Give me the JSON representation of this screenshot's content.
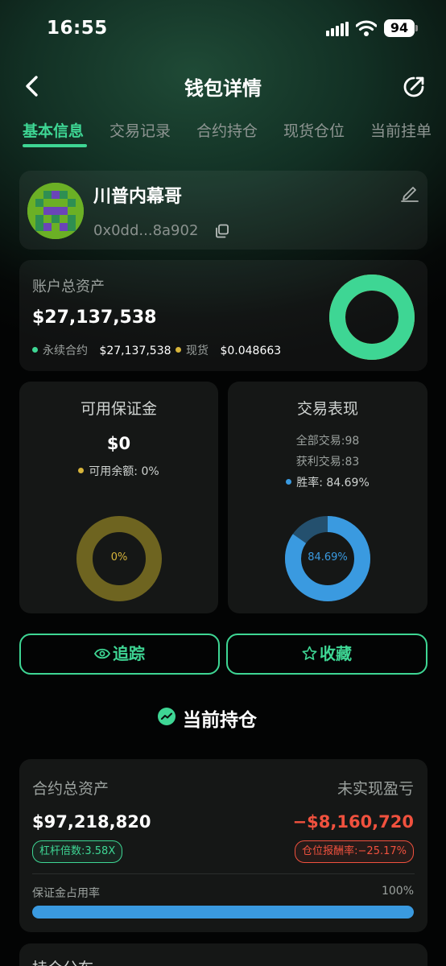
{
  "status_bar": {
    "time": "16:55",
    "battery": "94"
  },
  "header": {
    "title": "钱包详情"
  },
  "tabs": [
    {
      "label": "基本信息",
      "active": true
    },
    {
      "label": "交易记录",
      "active": false
    },
    {
      "label": "合约持仓",
      "active": false
    },
    {
      "label": "现货仓位",
      "active": false
    },
    {
      "label": "当前挂单",
      "active": false
    }
  ],
  "wallet": {
    "name": "川普内幕哥",
    "address": "0x0dd...8a902"
  },
  "total_assets": {
    "label": "账户总资产",
    "value": "$27,137,538",
    "legend": [
      {
        "name": "永续合约",
        "value": "$27,137,538",
        "color": "#3ed694"
      },
      {
        "name": "现货",
        "value": "$0.048663",
        "color": "#d7b43b"
      }
    ],
    "perp_fraction": 1.0
  },
  "margin": {
    "title": "可用保证金",
    "value": "$0",
    "balance_label": "可用余额: 0%",
    "donut_label": "0%",
    "fraction": 0,
    "color": "#6e6420"
  },
  "performance": {
    "title": "交易表现",
    "total_trades": "全部交易:98",
    "profit_trades": "获利交易:83",
    "win_rate_label": "胜率: 84.69%",
    "donut_label": "84.69%",
    "fraction": 0.8469,
    "color": "#3a9ae0"
  },
  "actions": {
    "track": "追踪",
    "favorite": "收藏"
  },
  "positions": {
    "section_title": "当前持仓",
    "contract_assets_label": "合约总资产",
    "contract_assets_value": "$97,218,820",
    "unrealized_label": "未实现盈亏",
    "unrealized_value": "−$8,160,720",
    "leverage": "杠杆倍数:3.58X",
    "roe": "仓位报酬率:−25.17%",
    "margin_usage_label": "保证金占用率",
    "margin_usage_value": "100%",
    "margin_usage_fraction": 1.0
  },
  "next_card": {
    "title": "持仓分布"
  },
  "colors": {
    "accent": "#3ed694",
    "negative": "#f0513e",
    "blue": "#3a9ae0"
  }
}
